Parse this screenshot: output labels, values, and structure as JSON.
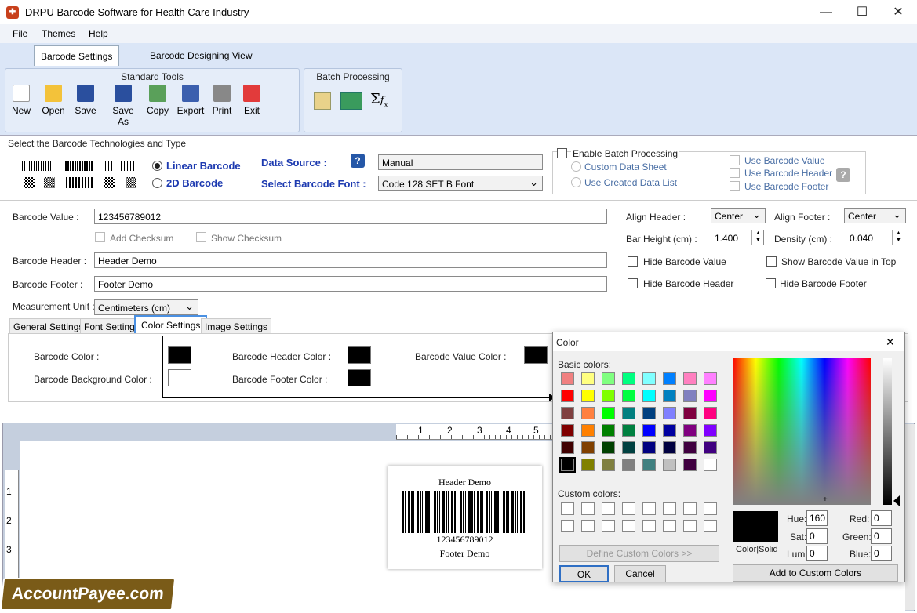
{
  "window": {
    "title": "DRPU Barcode Software for Health Care Industry",
    "minimize": "—",
    "maximize": "☐",
    "close": "✕"
  },
  "menu": [
    "File",
    "Themes",
    "Help"
  ],
  "ribbon_tabs": [
    "Barcode Settings",
    "Barcode Designing View"
  ],
  "standard_tools": {
    "title": "Standard Tools",
    "items": [
      "New",
      "Open",
      "Save",
      "Save As",
      "Copy",
      "Export",
      "Print",
      "Exit"
    ]
  },
  "batch": {
    "title": "Batch Processing"
  },
  "tech": {
    "title": "Select the Barcode Technologies and Type",
    "linear": "Linear Barcode",
    "twod": "2D Barcode",
    "data_source_label": "Data Source :",
    "data_source_value": "Manual",
    "font_label": "Select Barcode Font :",
    "font_value": "Code 128 SET B Font",
    "help": "?"
  },
  "batch_opts": {
    "enable": "Enable Batch Processing",
    "custom": "Custom Data Sheet",
    "created": "Use Created Data List",
    "use_value": "Use Barcode Value",
    "use_header": "Use Barcode Header",
    "use_footer": "Use Barcode Footer"
  },
  "form": {
    "value_label": "Barcode Value :",
    "value": "123456789012",
    "add_checksum": "Add Checksum",
    "show_checksum": "Show Checksum",
    "header_label": "Barcode Header :",
    "header": "Header Demo",
    "footer_label": "Barcode Footer :",
    "footer": "Footer Demo",
    "unit_label": "Measurement Unit :",
    "unit": "Centimeters (cm)"
  },
  "right": {
    "align_header_label": "Align Header  :",
    "align_header": "Center",
    "align_footer_label": "Align Footer  :",
    "align_footer": "Center",
    "bar_height_label": "Bar Height (cm) :",
    "bar_height": "1.400",
    "density_label": "Density (cm)  :",
    "density": "0.040",
    "hide_value": "Hide Barcode Value",
    "show_top": "Show Barcode Value in Top",
    "hide_header": "Hide Barcode Header",
    "hide_footer": "Hide Barcode Footer"
  },
  "settings_tabs": [
    "General Settings",
    "Font Settings",
    "Color Settings",
    "Image Settings"
  ],
  "colors": {
    "barcode": "Barcode Color :",
    "background": "Barcode Background Color :",
    "header": "Barcode Header Color :",
    "footer": "Barcode Footer Color :",
    "value": "Barcode Value Color :"
  },
  "ruler_top": [
    "1",
    "2",
    "3",
    "4",
    "5"
  ],
  "ruler_left": [
    "1",
    "2",
    "3"
  ],
  "preview": {
    "header": "Header Demo",
    "value": "123456789012",
    "footer": "Footer Demo"
  },
  "watermark": "AccountPayee.com",
  "dialog": {
    "title": "Color",
    "close": "✕",
    "basic": "Basic colors:",
    "custom": "Custom colors:",
    "define": "Define Custom Colors >>",
    "ok": "OK",
    "cancel": "Cancel",
    "colorsolid": "Color|Solid",
    "hue_l": "Hue:",
    "hue": "160",
    "sat_l": "Sat:",
    "sat": "0",
    "lum_l": "Lum:",
    "lum": "0",
    "red_l": "Red:",
    "red": "0",
    "green_l": "Green:",
    "green": "0",
    "blue_l": "Blue:",
    "blue": "0",
    "add": "Add to Custom Colors",
    "basic_colors": [
      "#f08080",
      "#ffff80",
      "#80ff80",
      "#00ff80",
      "#80ffff",
      "#0080ff",
      "#ff80c0",
      "#ff80ff",
      "#ff0000",
      "#ffff00",
      "#80ff00",
      "#00ff40",
      "#00ffff",
      "#0080c0",
      "#8080c0",
      "#ff00ff",
      "#804040",
      "#ff8040",
      "#00ff00",
      "#008080",
      "#004080",
      "#8080ff",
      "#800040",
      "#ff0080",
      "#800000",
      "#ff8000",
      "#008000",
      "#008040",
      "#0000ff",
      "#0000a0",
      "#800080",
      "#8000ff",
      "#400000",
      "#804000",
      "#004000",
      "#004040",
      "#000080",
      "#000040",
      "#400040",
      "#400080",
      "#000000",
      "#808000",
      "#808040",
      "#808080",
      "#408080",
      "#c0c0c0",
      "#400040",
      "#ffffff"
    ]
  }
}
